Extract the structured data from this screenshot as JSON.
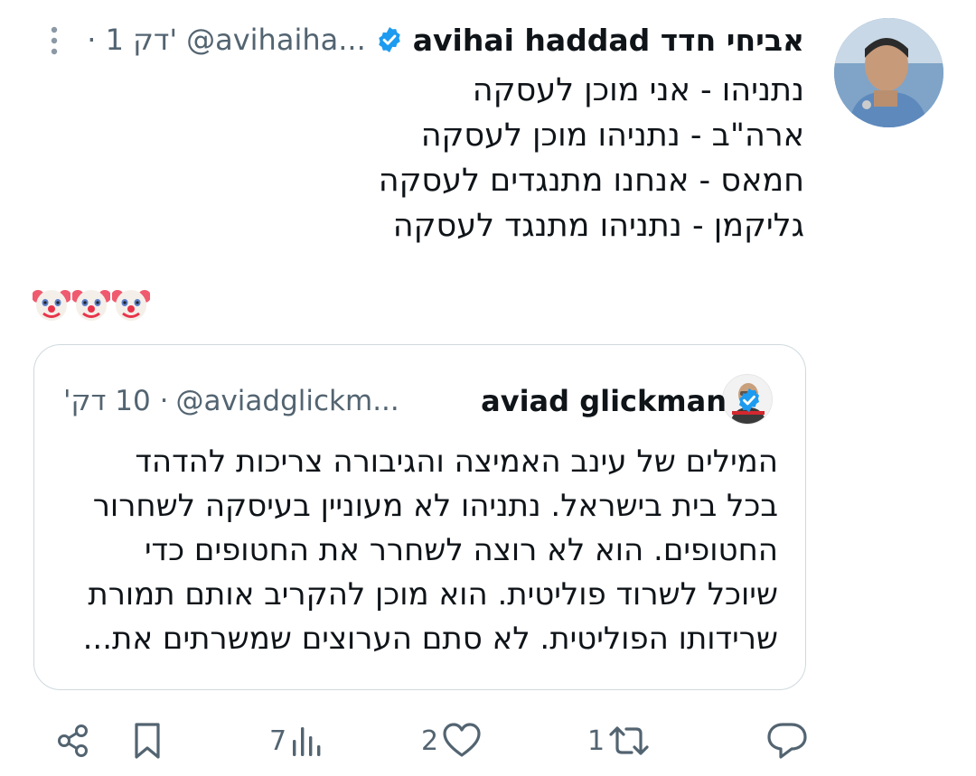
{
  "tweet": {
    "author_name": "avihai haddad אביחי חדד",
    "author_handle": "@avihaiha...",
    "time": "· 1 דק'",
    "lines": [
      "נתניהו - אני מוכן לעסקה",
      "ארה\"ב - נתניהו מוכן לעסקה",
      "חמאס - אנחנו מתנגדים לעסקה",
      "גליקמן - נתניהו מתנגד לעסקה"
    ],
    "emojis": [
      "clown-face",
      "clown-face",
      "clown-face"
    ],
    "verified": true
  },
  "quote": {
    "author_name": "aviad glickman",
    "author_handle": "@aviadglickm...",
    "time": "· 10 דק'",
    "verified": true,
    "lines": [
      "המילים של עינב האמיצה והגיבורה צריכות להדהד",
      "בכל בית בישראל. נתניהו לא מעוניין בעיסקה לשחרור",
      "החטופים. הוא לא רוצה לשחרר את החטופים כדי",
      "שיוכל לשרוד פוליטית. הוא מוכן להקריב אותם תמורת",
      "שרידותו הפוליטית. לא סתם הערוצים שמשרתים את..."
    ]
  },
  "actions": {
    "share": "share-icon",
    "bookmark": "bookmark-icon",
    "views": "7",
    "likes": "2",
    "retweets": "1",
    "reply": "reply-icon"
  },
  "colors": {
    "verified_blue": "#1d9bf0",
    "secondary_text": "#536471",
    "border": "#cfd9de"
  }
}
